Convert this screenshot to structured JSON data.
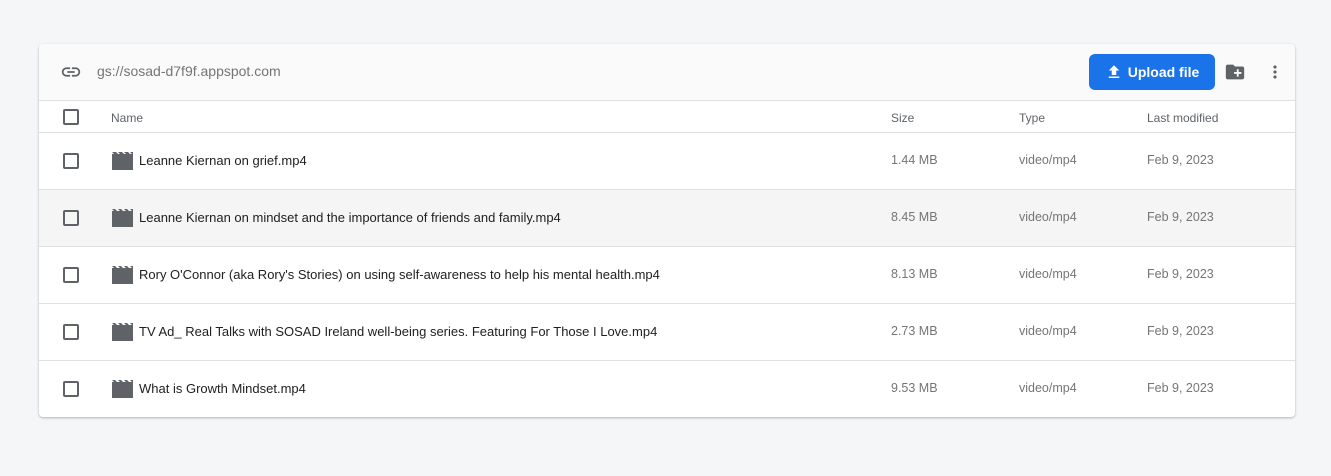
{
  "toolbar": {
    "path": "gs://sosad-d7f9f.appspot.com",
    "upload_label": "Upload file",
    "icons": {
      "link": "link-icon",
      "upload": "upload-icon",
      "new_folder": "create-folder-icon",
      "more": "more-vert-icon"
    },
    "accent_color": "#1a73e8"
  },
  "table": {
    "columns": {
      "name": "Name",
      "size": "Size",
      "type": "Type",
      "modified": "Last modified"
    },
    "rows": [
      {
        "name": "Leanne Kiernan on grief.mp4",
        "size": "1.44 MB",
        "type": "video/mp4",
        "modified": "Feb 9, 2023"
      },
      {
        "name": "Leanne Kiernan on mindset and the importance of friends and family.mp4",
        "size": "8.45 MB",
        "type": "video/mp4",
        "modified": "Feb 9, 2023"
      },
      {
        "name": "Rory O'Connor (aka Rory's Stories) on using self-awareness to help his mental health.mp4",
        "size": "8.13 MB",
        "type": "video/mp4",
        "modified": "Feb 9, 2023"
      },
      {
        "name": "TV Ad_ Real Talks with SOSAD Ireland well-being series. Featuring For Those I Love.mp4",
        "size": "2.73 MB",
        "type": "video/mp4",
        "modified": "Feb 9, 2023"
      },
      {
        "name": "What is Growth Mindset.mp4",
        "size": "9.53 MB",
        "type": "video/mp4",
        "modified": "Feb 9, 2023"
      }
    ],
    "file_icon": "movie-file-icon"
  }
}
